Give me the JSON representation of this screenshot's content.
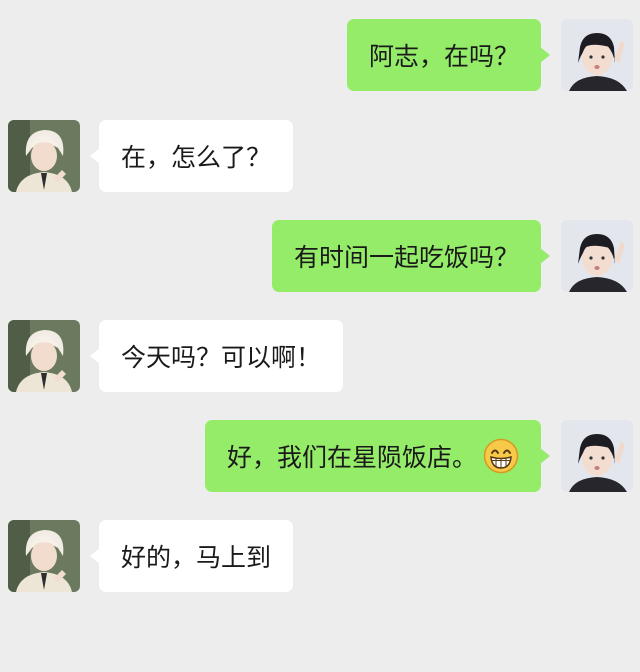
{
  "messages": [
    {
      "side": "sent",
      "text": "阿志，在吗？"
    },
    {
      "side": "recv",
      "text": "在，怎么了？"
    },
    {
      "side": "sent",
      "text": "有时间一起吃饭吗？"
    },
    {
      "side": "recv",
      "text": "今天吗？可以啊！"
    },
    {
      "side": "sent",
      "text": "好，我们在星陨饭店。",
      "emoji": "grinning-face-icon"
    },
    {
      "side": "recv",
      "text": "好的，马上到"
    }
  ],
  "colors": {
    "background": "#ededed",
    "sent_bubble": "#95ec69",
    "received_bubble": "#ffffff",
    "text": "#1a1a1a"
  }
}
